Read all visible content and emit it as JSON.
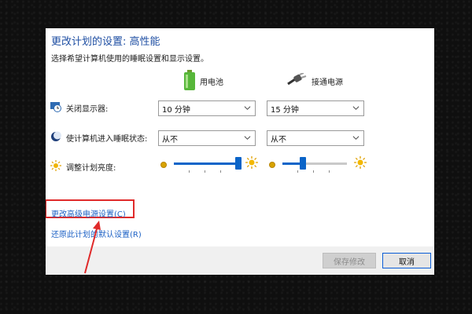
{
  "window": {
    "title": "更改计划的设置: 高性能",
    "subtitle": "选择希望计算机使用的睡眠设置和显示设置。"
  },
  "columns": {
    "battery": {
      "label": "用电池",
      "icon": "battery-icon"
    },
    "plugged": {
      "label": "接通电源",
      "icon": "power-plug-icon"
    }
  },
  "settings": {
    "display_off": {
      "label": "关闭显示器:",
      "icon": "monitor-clock-icon",
      "battery_value": "10 分钟",
      "plugged_value": "15 分钟"
    },
    "sleep": {
      "label": "使计算机进入睡眠状态:",
      "icon": "moon-icon",
      "battery_value": "从不",
      "plugged_value": "从不"
    },
    "brightness": {
      "label": "调整计划亮度:",
      "icon": "sun-icon",
      "battery_level_percent": 100,
      "plugged_level_percent": 30
    }
  },
  "links": {
    "advanced": "更改高级电源设置(C)",
    "restore": "还原此计划的默认设置(R)"
  },
  "buttons": {
    "save": "保存修改",
    "cancel": "取消"
  },
  "colors": {
    "accent": "#0a64c8",
    "highlight_box": "#e02a2a",
    "title": "#1f4fa3"
  }
}
